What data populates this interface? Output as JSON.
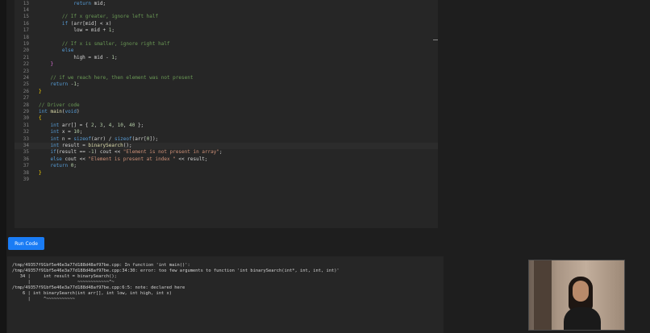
{
  "editor": {
    "active_line": "34",
    "lines": [
      {
        "num": "13",
        "tokens": [
          {
            "t": "            ",
            "c": "p"
          },
          {
            "t": "return",
            "c": "k"
          },
          {
            "t": " mid;",
            "c": "p"
          }
        ]
      },
      {
        "num": "14",
        "tokens": []
      },
      {
        "num": "15",
        "tokens": [
          {
            "t": "        ",
            "c": "p"
          },
          {
            "t": "// If x greater, ignore left half",
            "c": "c"
          }
        ]
      },
      {
        "num": "16",
        "tokens": [
          {
            "t": "        ",
            "c": "p"
          },
          {
            "t": "if",
            "c": "k"
          },
          {
            "t": " (arr[mid] < x)",
            "c": "p"
          }
        ]
      },
      {
        "num": "17",
        "tokens": [
          {
            "t": "            low = mid + ",
            "c": "p"
          },
          {
            "t": "1",
            "c": "n"
          },
          {
            "t": ";",
            "c": "p"
          }
        ]
      },
      {
        "num": "18",
        "tokens": []
      },
      {
        "num": "19",
        "tokens": [
          {
            "t": "        ",
            "c": "p"
          },
          {
            "t": "// If x is smaller, ignore right half",
            "c": "c"
          }
        ]
      },
      {
        "num": "20",
        "tokens": [
          {
            "t": "        ",
            "c": "p"
          },
          {
            "t": "else",
            "c": "k"
          }
        ]
      },
      {
        "num": "21",
        "tokens": [
          {
            "t": "            high = mid - ",
            "c": "p"
          },
          {
            "t": "1",
            "c": "n"
          },
          {
            "t": ";",
            "c": "p"
          }
        ]
      },
      {
        "num": "22",
        "tokens": [
          {
            "t": "    ",
            "c": "p"
          },
          {
            "t": "}",
            "c": "m"
          }
        ]
      },
      {
        "num": "23",
        "tokens": []
      },
      {
        "num": "24",
        "tokens": [
          {
            "t": "    ",
            "c": "p"
          },
          {
            "t": "// if we reach here, then element was not present",
            "c": "c"
          }
        ]
      },
      {
        "num": "25",
        "tokens": [
          {
            "t": "    ",
            "c": "p"
          },
          {
            "t": "return",
            "c": "k"
          },
          {
            "t": " -",
            "c": "p"
          },
          {
            "t": "1",
            "c": "n"
          },
          {
            "t": ";",
            "c": "p"
          }
        ]
      },
      {
        "num": "26",
        "tokens": [
          {
            "t": "}",
            "c": "b"
          }
        ]
      },
      {
        "num": "27",
        "tokens": []
      },
      {
        "num": "28",
        "tokens": [
          {
            "t": "// Driver code",
            "c": "c"
          }
        ]
      },
      {
        "num": "29",
        "tokens": [
          {
            "t": "int",
            "c": "k"
          },
          {
            "t": " ",
            "c": "p"
          },
          {
            "t": "main",
            "c": "f"
          },
          {
            "t": "(",
            "c": "p"
          },
          {
            "t": "void",
            "c": "k"
          },
          {
            "t": ")",
            "c": "p"
          }
        ]
      },
      {
        "num": "30",
        "tokens": [
          {
            "t": "{",
            "c": "b"
          }
        ]
      },
      {
        "num": "31",
        "tokens": [
          {
            "t": "    ",
            "c": "p"
          },
          {
            "t": "int",
            "c": "k"
          },
          {
            "t": " arr[] = { ",
            "c": "p"
          },
          {
            "t": "2",
            "c": "n"
          },
          {
            "t": ", ",
            "c": "p"
          },
          {
            "t": "3",
            "c": "n"
          },
          {
            "t": ", ",
            "c": "p"
          },
          {
            "t": "4",
            "c": "n"
          },
          {
            "t": ", ",
            "c": "p"
          },
          {
            "t": "10",
            "c": "n"
          },
          {
            "t": ", ",
            "c": "p"
          },
          {
            "t": "40",
            "c": "n"
          },
          {
            "t": " };",
            "c": "p"
          }
        ]
      },
      {
        "num": "32",
        "tokens": [
          {
            "t": "    ",
            "c": "p"
          },
          {
            "t": "int",
            "c": "k"
          },
          {
            "t": " x = ",
            "c": "p"
          },
          {
            "t": "10",
            "c": "n"
          },
          {
            "t": ";",
            "c": "p"
          }
        ]
      },
      {
        "num": "33",
        "tokens": [
          {
            "t": "    ",
            "c": "p"
          },
          {
            "t": "int",
            "c": "k"
          },
          {
            "t": " n = ",
            "c": "p"
          },
          {
            "t": "sizeof",
            "c": "k"
          },
          {
            "t": "(arr) / ",
            "c": "p"
          },
          {
            "t": "sizeof",
            "c": "k"
          },
          {
            "t": "(arr[",
            "c": "p"
          },
          {
            "t": "0",
            "c": "n"
          },
          {
            "t": "]);",
            "c": "p"
          }
        ]
      },
      {
        "num": "34",
        "tokens": [
          {
            "t": "    ",
            "c": "p"
          },
          {
            "t": "int",
            "c": "k"
          },
          {
            "t": " result = ",
            "c": "p"
          },
          {
            "t": "binarySearch",
            "c": "f"
          },
          {
            "t": "();",
            "c": "p"
          }
        ]
      },
      {
        "num": "35",
        "tokens": [
          {
            "t": "    ",
            "c": "p"
          },
          {
            "t": "if",
            "c": "k"
          },
          {
            "t": "(result == -",
            "c": "p"
          },
          {
            "t": "1",
            "c": "n"
          },
          {
            "t": ") cout << ",
            "c": "p"
          },
          {
            "t": "\"Element is not present in array\"",
            "c": "s"
          },
          {
            "t": ";",
            "c": "p"
          }
        ]
      },
      {
        "num": "36",
        "tokens": [
          {
            "t": "    ",
            "c": "p"
          },
          {
            "t": "else",
            "c": "k"
          },
          {
            "t": " cout << ",
            "c": "p"
          },
          {
            "t": "\"Element is present at index \"",
            "c": "s"
          },
          {
            "t": " << result;",
            "c": "p"
          }
        ]
      },
      {
        "num": "37",
        "tokens": [
          {
            "t": "    ",
            "c": "p"
          },
          {
            "t": "return",
            "c": "k"
          },
          {
            "t": " ",
            "c": "p"
          },
          {
            "t": "0",
            "c": "n"
          },
          {
            "t": ";",
            "c": "p"
          }
        ]
      },
      {
        "num": "38",
        "tokens": [
          {
            "t": "}",
            "c": "b"
          }
        ]
      },
      {
        "num": "39",
        "tokens": []
      }
    ]
  },
  "run_button": {
    "label": "Run Code"
  },
  "output": {
    "lines": [
      "/tmp/49357f91bf5e46e3a77d188d48af97be.cpp: In function 'int main()':",
      "/tmp/49357f91bf5e46e3a77d188d48af97be.cpp:34:30: error: too few arguments to function 'int binarySearch(int*, int, int, int)'",
      "   34 |     int result = binarySearch();",
      "      |                  ~~~~~~~~~~~~^~",
      "/tmp/49357f91bf5e46e3a77d188d48af97be.cpp:6:5: note: declared here",
      "    6 | int binarySearch(int arr[], int low, int high, int x)",
      "      |     ^~~~~~~~~~~~"
    ]
  },
  "colors": {
    "background": "#1e1e1e",
    "panel": "#262626",
    "run_button": "#1a7cf5"
  }
}
